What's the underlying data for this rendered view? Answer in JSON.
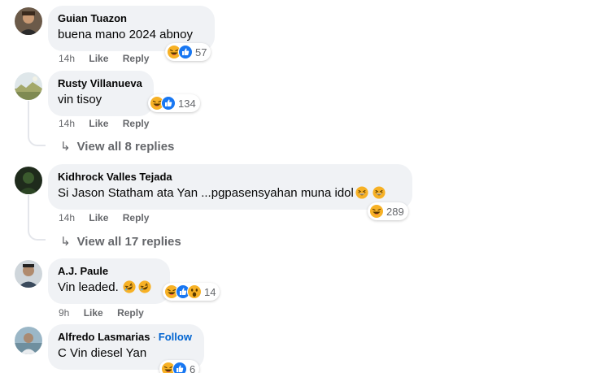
{
  "icons": {
    "haha": "haha-reaction-icon",
    "like": "like-reaction-icon",
    "wow": "wow-reaction-icon",
    "reply_arrow": "reply-arrow-icon"
  },
  "colors": {
    "bubble": "#f0f2f5",
    "meta": "#65676b",
    "follow": "#0064d1",
    "like_blue": "#1877f2",
    "haha_yellow": "#f7b125"
  },
  "comments": [
    {
      "author": "Guian Tuazon",
      "text": "buena mano 2024 abnoy",
      "time": "14h",
      "like": "Like",
      "reply": "Reply",
      "reactions": [
        "haha",
        "like"
      ],
      "reaction_count": "57"
    },
    {
      "author": "Rusty Villanueva",
      "text": "vin tisoy",
      "time": "14h",
      "like": "Like",
      "reply": "Reply",
      "reactions": [
        "haha",
        "like"
      ],
      "reaction_count": "134",
      "view_replies": "View all 8 replies"
    },
    {
      "author": "Kidhrock Valles Tejada",
      "text": "Si Jason Statham ata Yan ...pgpasensyahan muna idol",
      "inline_emojis": [
        "grinning-squint",
        "grinning-squint"
      ],
      "time": "14h",
      "like": "Like",
      "reply": "Reply",
      "reactions": [
        "haha"
      ],
      "reaction_count": "289",
      "view_replies": "View all 17 replies"
    },
    {
      "author": "A.J. Paule",
      "text": "Vin leaded.",
      "inline_emojis": [
        "rolling-laughing",
        "rolling-laughing"
      ],
      "time": "9h",
      "like": "Like",
      "reply": "Reply",
      "reactions": [
        "haha",
        "like",
        "wow"
      ],
      "reaction_count": "14"
    },
    {
      "author": "Alfredo Lasmarias",
      "follow_separator": "·",
      "follow": "Follow",
      "text": "C Vin diesel Yan",
      "reactions": [
        "haha",
        "like"
      ],
      "reaction_count": "6"
    }
  ]
}
